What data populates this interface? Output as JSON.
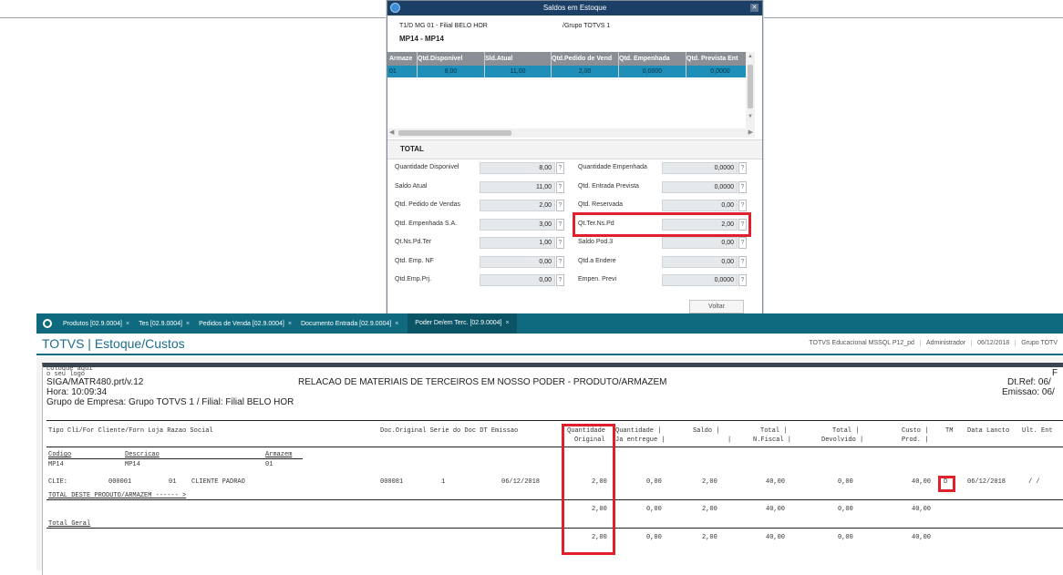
{
  "dialog": {
    "title": "Saldos em Estoque",
    "branch": "T1/D MG 01  - Filial BELO HOR",
    "group": "/Grupo TOTVS 1",
    "product": "MP14 - MP14",
    "columns": [
      "Armaze",
      "Qtd.Disponivel",
      "Sld.Atual",
      "Qtd.Pedido de Vend",
      "Qtd. Empenhada",
      "Qtd. Prevista Ent"
    ],
    "row": [
      "01",
      "8,00",
      "11,00",
      "2,00",
      "0,0000",
      "0,0000"
    ],
    "total_label": "TOTAL",
    "fields_left": [
      {
        "label": "Quantidade Disponivel",
        "value": "8,00"
      },
      {
        "label": "Saldo Atual",
        "value": "11,00"
      },
      {
        "label": "Qtd. Pedido de Vendas",
        "value": "2,00"
      },
      {
        "label": "Qtd. Empenhada S.A.",
        "value": "3,00"
      },
      {
        "label": "Qt.Ns.Pd.Ter",
        "value": "1,00"
      },
      {
        "label": "Qtd. Emp. NF",
        "value": "0,00"
      },
      {
        "label": "Qtd.Emp.Prj.",
        "value": "0,00"
      }
    ],
    "fields_right": [
      {
        "label": "Quantidade Empenhada",
        "value": "0,0000"
      },
      {
        "label": "Qtd. Entrada Prevista",
        "value": "0,0000"
      },
      {
        "label": "Qtd. Reservada",
        "value": "0,00"
      },
      {
        "label": "Qt.Ter.Ns.Pd",
        "value": "2,00"
      },
      {
        "label": "Saldo Pod.3",
        "value": "0,00"
      },
      {
        "label": "Qtd.a Endere",
        "value": "0,00"
      },
      {
        "label": "Empen. Previ",
        "value": "0,0000"
      }
    ],
    "help_mark": "?",
    "voltar": "Voltar"
  },
  "tabs": [
    {
      "label": "Produtos [02.9.0004]",
      "close": "×"
    },
    {
      "label": "Tes [02.9.0004]",
      "close": "×"
    },
    {
      "label": "Pedidos de Venda [02.9.0004]",
      "close": "×"
    },
    {
      "label": "Documento Entrada [02.9.0004]",
      "close": "×"
    },
    {
      "label": "Poder De/em Terc. [02.9.0004]",
      "close": "×"
    }
  ],
  "app": {
    "title": "TOTVS | Estoque/Custos",
    "env": "TOTVS Educacional MSSQL P12_pd",
    "user": "Administrador",
    "date": "06/12/2018",
    "group": "Grupo TOTV"
  },
  "report": {
    "logo": "coloque aqui\no seu logo",
    "program": "SIGA/MATR480.prt/v.12",
    "hora": "Hora: 10:09:34",
    "empresa": "Grupo de Empresa: Grupo TOTVS 1 / Filial: Filial BELO HOR",
    "title": "RELACAO DE MATERIAIS DE TERCEIROS EM NOSSO PODER - PRODUTO/ARMAZEM",
    "right_f": "F",
    "dtref": "Dt.Ref: 06/",
    "emissao": "Emissao: 06/",
    "head1": "Tipo Cli/For  Cliente/Forn  Loja  Razao Social",
    "head_doc": "Doc.Original  Serie do Doc  DT Emissao",
    "head_qo1": "Quantidade",
    "head_qo2": "Original",
    "head_qe1": "Quantidade   |",
    "head_qe2": "Ja entregue  |",
    "head_saldo1": "Saldo   |",
    "head_saldo2": "|",
    "head_tnf1": "Total   |",
    "head_tnf2": "N.Fiscal  |",
    "head_tdev1": "Total   |",
    "head_tdev2": "Devolvido   |",
    "head_custo1": "Custo  |",
    "head_custo2": "Prod.  |",
    "head_tm": "TM",
    "head_data": "Data Lancto",
    "head_ult": "Ult. Ent",
    "sub_codigo": "Codigo",
    "sub_descricao": "Descricao",
    "sub_armazem": "Armazem",
    "prod_codigo": "MP14",
    "prod_desc": "MP14",
    "prod_arm": "01",
    "line": {
      "tipo": "CLIE:",
      "cliente": "000001",
      "loja": "01",
      "razao": "CLIENTE PADRAO",
      "doc": "000081",
      "serie": "1",
      "emissao": "06/12/2018",
      "qtd_orig": "2,00",
      "qtd_entr": "0,00",
      "saldo": "2,00",
      "total_nf": "40,00",
      "total_dev": "0,00",
      "custo": "40,00",
      "tm": "D",
      "data": "06/12/2018",
      "ult": "/  /"
    },
    "total_prod_label": "TOTAL DESTE PRODUTO/ARMAZEM ------ >",
    "total_prod": [
      "2,00",
      "0,00",
      "2,00",
      "40,00",
      "0,00",
      "40,00"
    ],
    "total_geral_label": "Total Geral",
    "total_geral": [
      "2,00",
      "0,00",
      "2,00",
      "40,00",
      "0,00",
      "40,00"
    ]
  }
}
